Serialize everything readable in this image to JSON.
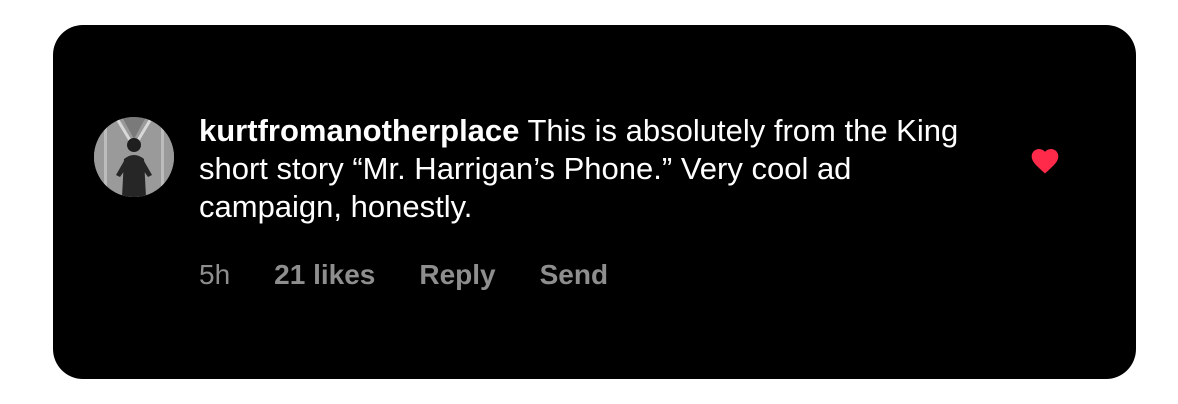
{
  "comment": {
    "username": "kurtfromanotherplace",
    "text": "This is absolutely from the King short story “Mr. Harrigan’s Phone.” Very cool ad campaign, honestly.",
    "time": "5h",
    "likes": "21 likes",
    "reply_label": "Reply",
    "send_label": "Send",
    "liked": true
  },
  "colors": {
    "background": "#000000",
    "text": "#ffffff",
    "meta_text": "#8e8e8e",
    "heart": "#ff2a4a"
  },
  "icons": {
    "avatar": "avatar",
    "like": "heart-icon"
  }
}
